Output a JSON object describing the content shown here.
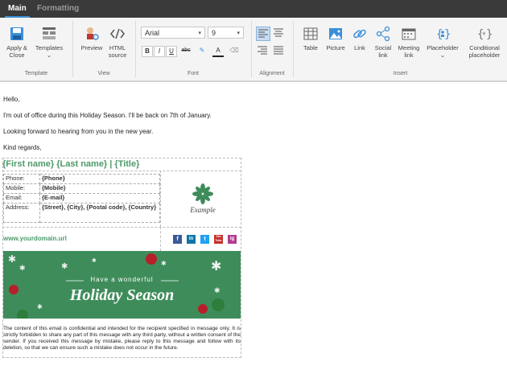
{
  "tabs": {
    "main": "Main",
    "formatting": "Formatting"
  },
  "ribbon": {
    "template_group": {
      "label": "Template",
      "apply_close": "Apply &",
      "apply_close2": "Close",
      "templates": "Templates"
    },
    "view_group": {
      "label": "View",
      "preview": "Preview",
      "html_source": "HTML",
      "html_source2": "source"
    },
    "font_group": {
      "label": "Font",
      "font_name": "Arial",
      "font_size": "9",
      "bold": "B",
      "italic": "I",
      "underline": "U",
      "strike": "abc"
    },
    "alignment_group": {
      "label": "Alignment"
    },
    "insert_group": {
      "label": "Insert",
      "table": "Table",
      "picture": "Picture",
      "link": "Link",
      "social_link": "Social",
      "social_link2": "link",
      "meeting_link": "Meeting",
      "meeting_link2": "link",
      "placeholder": "Placeholder",
      "conditional_placeholder": "Conditional",
      "conditional_placeholder2": "placeholder"
    }
  },
  "email": {
    "greeting": "Hello,",
    "line1": "I'm out of office during this Holiday Season. I'll be back on 7th of January.",
    "line2": "Looking forward to hearing from you in the new year.",
    "closing": "Kind regards,"
  },
  "signature": {
    "name_line": "{First name} {Last name} | {Title}",
    "details": [
      {
        "label": "Phone:",
        "value": "{Phone}"
      },
      {
        "label": "Mobile:",
        "value": "{Mobile}"
      },
      {
        "label": "Email:",
        "value": "{E-mail}"
      },
      {
        "label": "Address:",
        "value": "{Street}, {City}, {Postal code}, {Country}"
      }
    ],
    "logo_text": "Example",
    "website": "www.yourdomain.url",
    "social": [
      "f",
      "in",
      "t",
      "You Tube",
      "ig"
    ],
    "banner": {
      "line1": "Have a wonderful",
      "line2": "Holiday Season"
    },
    "disclaimer": "The content of this email is confidential and intended for the recipient specified in message only. It is strictly forbidden to share any part of this message with any third party, without a written consent of the sender. If you received this message by mistake, please reply to this message and follow with its deletion, so that we can ensure such a mistake does not occur in the future."
  },
  "colors": {
    "accent": "#3b8fd9",
    "brand_green": "#4d9a6a",
    "banner_green": "#3f8c5b"
  }
}
